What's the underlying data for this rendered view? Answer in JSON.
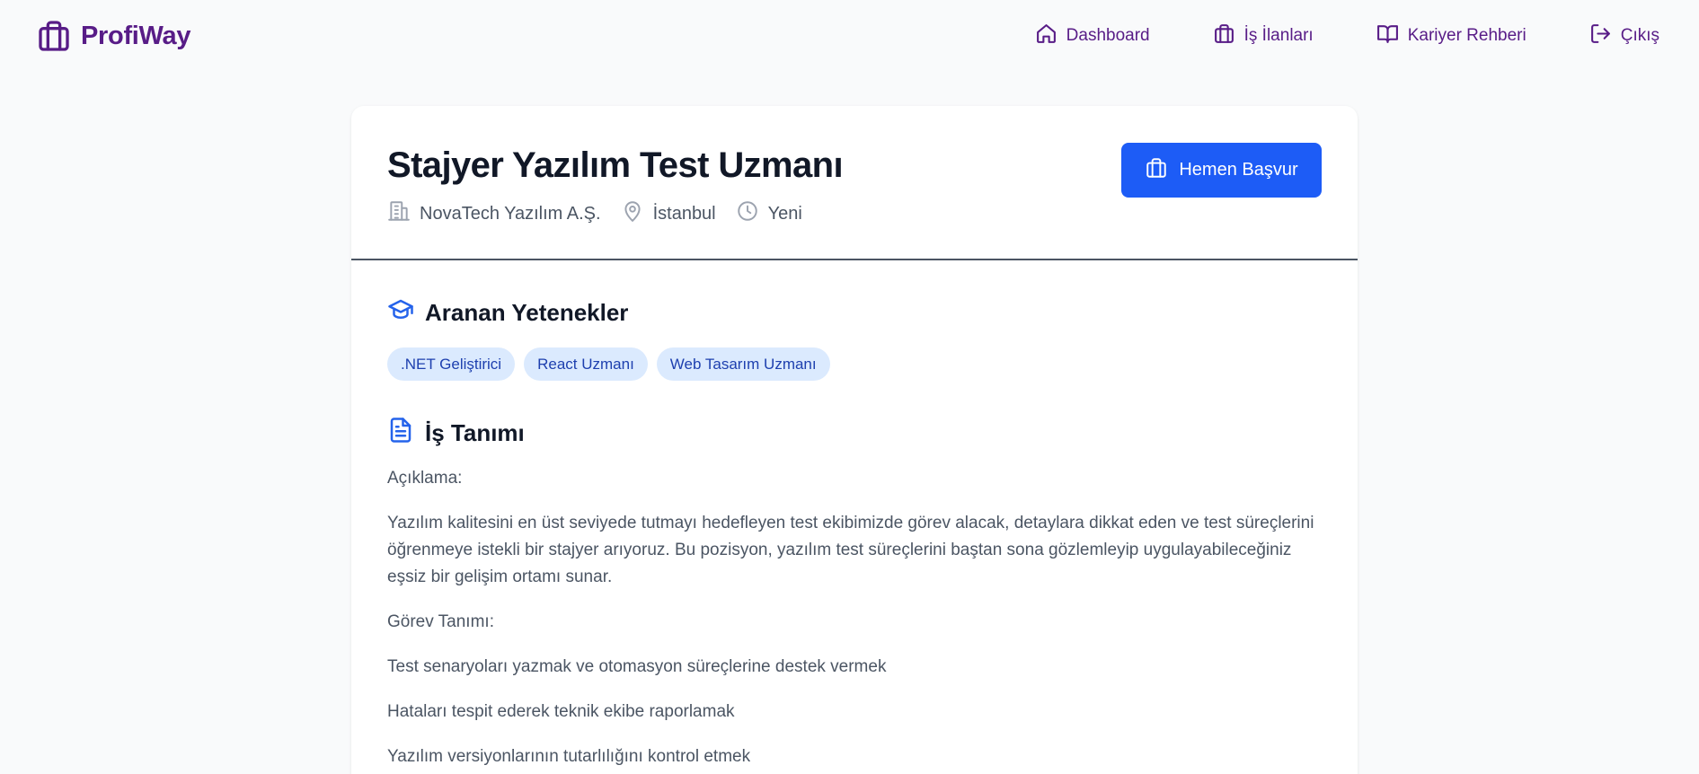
{
  "brand": {
    "name": "ProfiWay"
  },
  "nav": {
    "items": [
      {
        "label": "Dashboard",
        "icon": "home-icon"
      },
      {
        "label": "İş İlanları",
        "icon": "briefcase-icon"
      },
      {
        "label": "Kariyer Rehberi",
        "icon": "book-icon"
      },
      {
        "label": "Çıkış",
        "icon": "logout-icon"
      }
    ]
  },
  "job": {
    "title": "Stajyer Yazılım Test Uzmanı",
    "company": "NovaTech Yazılım A.Ş.",
    "location": "İstanbul",
    "posted": "Yeni",
    "apply_label": "Hemen Başvur"
  },
  "skills": {
    "title": "Aranan Yetenekler",
    "items": [
      ".NET Geliştirici",
      "React Uzmanı",
      "Web Tasarım Uzmanı"
    ]
  },
  "description": {
    "title": "İş Tanımı",
    "label": "Açıklama:",
    "text": "Yazılım kalitesini en üst seviyede tutmayı hedefleyen test ekibimizde görev alacak, detaylara dikkat eden ve test süreçlerini öğrenmeye istekli bir stajyer arıyoruz. Bu pozisyon, yazılım test süreçlerini baştan sona gözlemleyip uygulayabileceğiniz eşsiz bir gelişim ortamı sunar.",
    "duties_label": "Görev Tanımı:",
    "duties": [
      "Test senaryoları yazmak ve otomasyon süreçlerine destek vermek",
      "Hataları tespit ederek teknik ekibe raporlamak",
      "Yazılım versiyonlarının tutarlılığını kontrol etmek"
    ]
  },
  "colors": {
    "brand": "#581c87",
    "primary_button": "#1d5cf6",
    "skill_badge_bg": "#dbeafe",
    "skill_badge_text": "#1e40af"
  }
}
